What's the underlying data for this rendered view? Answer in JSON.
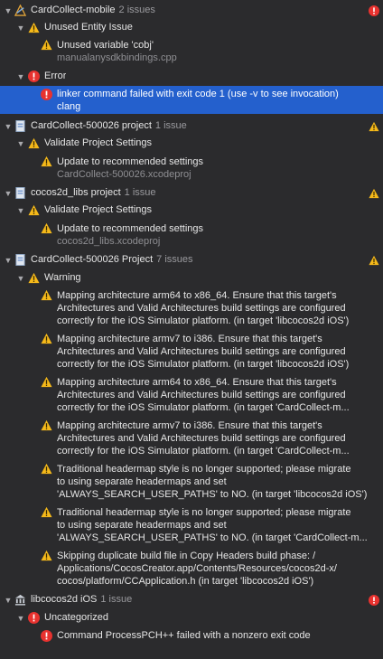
{
  "groups": [
    {
      "title": "CardCollect-mobile",
      "count": "2 issues"
    },
    {
      "title": "Unused Entity Issue"
    },
    {
      "title": "Unused variable 'cobj'",
      "file": "manualanysdkbindings.cpp"
    },
    {
      "title": "Error"
    },
    {
      "lines": [
        "linker command failed with exit code 1 (use -v to see invocation)",
        "clang"
      ]
    },
    {
      "title": "CardCollect-500026 project",
      "count": "1 issue"
    },
    {
      "title": "Validate Project Settings"
    },
    {
      "title": "Update to recommended settings",
      "file": "CardCollect-500026.xcodeproj"
    },
    {
      "title": "cocos2d_libs project",
      "count": "1 issue"
    },
    {
      "title": "Validate Project Settings"
    },
    {
      "title": "Update to recommended settings",
      "file": "cocos2d_libs.xcodeproj"
    },
    {
      "title": "CardCollect-500026 Project",
      "count": "7 issues"
    },
    {
      "title": "Warning"
    },
    {
      "lines": [
        "Mapping architecture arm64 to x86_64. Ensure that this target's",
        "Architectures and Valid Architectures build settings are configured",
        "correctly for the iOS Simulator platform. (in target 'libcocos2d iOS')"
      ]
    },
    {
      "lines": [
        "Mapping architecture armv7 to i386. Ensure that this target's",
        "Architectures and Valid Architectures build settings are configured",
        "correctly for the iOS Simulator platform. (in target 'libcocos2d iOS')"
      ]
    },
    {
      "lines": [
        "Mapping architecture arm64 to x86_64. Ensure that this target's",
        "Architectures and Valid Architectures build settings are configured",
        "correctly for the iOS Simulator platform. (in target 'CardCollect-m..."
      ]
    },
    {
      "lines": [
        "Mapping architecture armv7 to i386. Ensure that this target's",
        "Architectures and Valid Architectures build settings are configured",
        "correctly for the iOS Simulator platform. (in target 'CardCollect-m..."
      ]
    },
    {
      "lines": [
        "Traditional headermap style is no longer supported; please migrate",
        "to using separate headermaps and set",
        "'ALWAYS_SEARCH_USER_PATHS' to NO. (in target 'libcocos2d iOS')"
      ]
    },
    {
      "lines": [
        "Traditional headermap style is no longer supported; please migrate",
        "to using separate headermaps and set",
        "'ALWAYS_SEARCH_USER_PATHS' to NO. (in target 'CardCollect-m..."
      ]
    },
    {
      "lines": [
        "Skipping duplicate build file in Copy Headers build phase: /",
        "Applications/CocosCreator.app/Contents/Resources/cocos2d-x/",
        "cocos/platform/CCApplication.h (in target 'libcocos2d iOS')"
      ]
    },
    {
      "title": "libcocos2d iOS",
      "count": "1 issue"
    },
    {
      "title": "Uncategorized"
    },
    {
      "title": "Command ProcessPCH++ failed with a nonzero exit code"
    }
  ],
  "colors": {
    "warning": "#f5b91a",
    "error": "#e8322f",
    "selected": "#2460cd"
  }
}
